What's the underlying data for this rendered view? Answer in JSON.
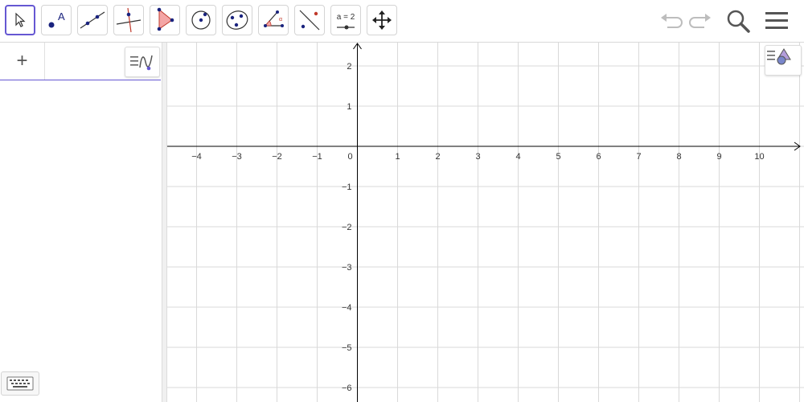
{
  "toolbar": {
    "tools": [
      {
        "name": "move-tool",
        "icon": "move-arrow-icon"
      },
      {
        "name": "point-tool",
        "icon": "point-icon",
        "text": "A"
      },
      {
        "name": "line-tool",
        "icon": "line-icon"
      },
      {
        "name": "perpendicular-line-tool",
        "icon": "perpendicular-line-icon"
      },
      {
        "name": "polygon-tool",
        "icon": "polygon-icon"
      },
      {
        "name": "circle-center-point-tool",
        "icon": "circle-center-point-icon"
      },
      {
        "name": "circle-three-points-tool",
        "icon": "circle-three-points-icon"
      },
      {
        "name": "angle-tool",
        "icon": "angle-icon"
      },
      {
        "name": "reflect-tool",
        "icon": "reflect-icon"
      },
      {
        "name": "slider-tool",
        "icon": "slider-icon",
        "text": "a = 2"
      },
      {
        "name": "move-graphics-view-tool",
        "icon": "move-view-icon"
      }
    ],
    "selected_tool": "move-tool",
    "right_icons": [
      "undo-icon",
      "redo-icon",
      "search-icon",
      "menu-icon"
    ]
  },
  "algebra": {
    "input_plus": "+"
  },
  "graphics": {
    "x_ticks": [
      "−4",
      "−3",
      "−2",
      "−1",
      "0",
      "1",
      "2",
      "3",
      "4",
      "5",
      "6",
      "7",
      "8",
      "9",
      "10"
    ],
    "y_ticks": [
      "2",
      "1",
      "−1",
      "−2",
      "−3",
      "−4",
      "−5",
      "−6"
    ],
    "grid": true,
    "axis_color": "#000000",
    "grid_color": "#d9d9d9"
  },
  "colors": {
    "accent": "#6557d2",
    "point": "#1a237e",
    "polygon_fill": "#f4a6a6"
  }
}
